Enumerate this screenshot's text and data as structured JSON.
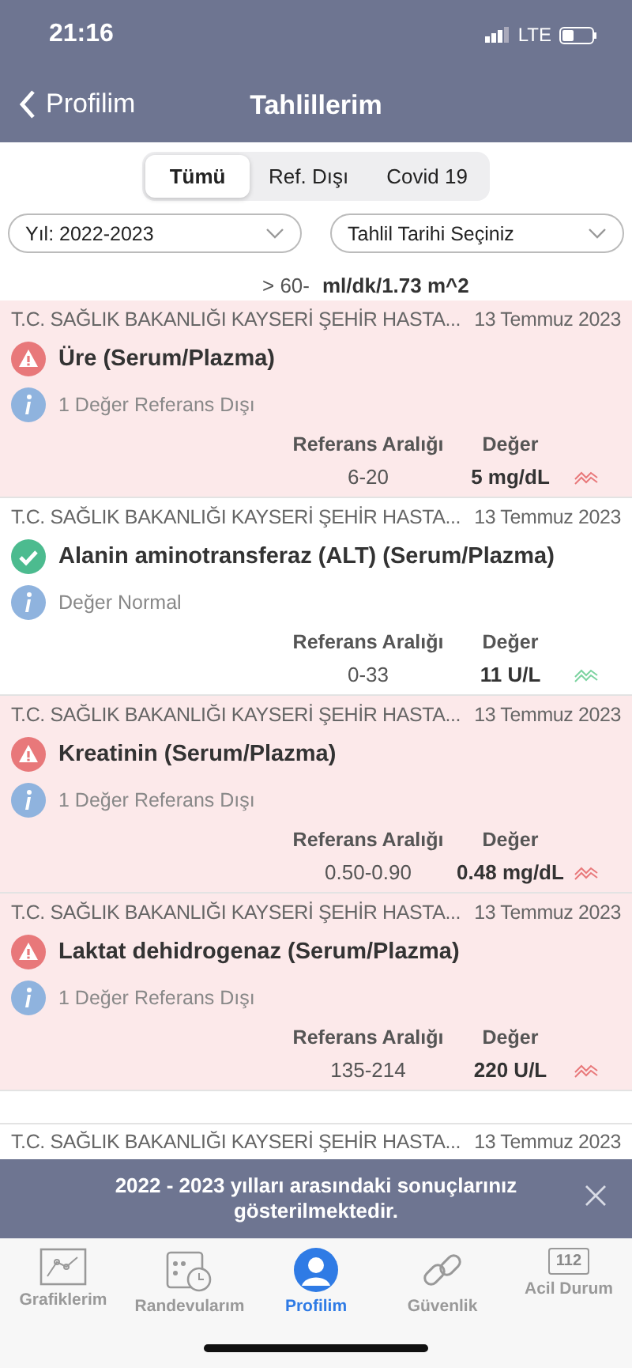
{
  "status_bar": {
    "time": "21:16",
    "network": "LTE"
  },
  "nav": {
    "back": "Profilim",
    "title": "Tahlillerim"
  },
  "segments": [
    {
      "label": "Tümü",
      "selected": true
    },
    {
      "label": "Ref. Dışı",
      "selected": false
    },
    {
      "label": "Covid 19",
      "selected": false
    }
  ],
  "filters": [
    {
      "value": "Yıl: 2022-2023"
    },
    {
      "value": "Tahlil Tarihi Seçiniz"
    }
  ],
  "partial_row": {
    "range": "> 60-",
    "value": "ml/dk/1.73 m^2"
  },
  "results": [
    {
      "hospital": "T.C. SAĞLIK BAKANLIĞI KAYSERİ ŞEHİR HASTA...",
      "date": "13 Temmuz 2023",
      "kind": "abnormal",
      "title": "Üre (Serum/Plazma)",
      "note": "1 Değer Referans Dışı",
      "range_label": "Referans Aralığı",
      "value_label": "Değer",
      "range": "6-20",
      "value": "5 mg/dL"
    },
    {
      "hospital": "T.C. SAĞLIK BAKANLIĞI KAYSERİ ŞEHİR HASTA...",
      "date": "13 Temmuz 2023",
      "kind": "normal",
      "title": "Alanin aminotransferaz (ALT) (Serum/Plazma)",
      "note": "Değer Normal",
      "range_label": "Referans Aralığı",
      "value_label": "Değer",
      "range": "0-33",
      "value": "11 U/L"
    },
    {
      "hospital": "T.C. SAĞLIK BAKANLIĞI KAYSERİ ŞEHİR HASTA...",
      "date": "13 Temmuz 2023",
      "kind": "abnormal",
      "title": "Kreatinin (Serum/Plazma)",
      "note": "1 Değer Referans Dışı",
      "range_label": "Referans Aralığı",
      "value_label": "Değer",
      "range": "0.50-0.90",
      "value": "0.48 mg/dL"
    },
    {
      "hospital": "T.C. SAĞLIK BAKANLIĞI KAYSERİ ŞEHİR HASTA...",
      "date": "13 Temmuz 2023",
      "kind": "abnormal",
      "title": "Laktat dehidrogenaz (Serum/Plazma)",
      "note": "1 Değer Referans Dışı",
      "range_label": "Referans Aralığı",
      "value_label": "Değer",
      "range": "135-214",
      "value": "220 U/L"
    }
  ],
  "partial_result": {
    "hospital": "T.C. SAĞLIK BAKANLIĞI KAYSERİ ŞEHİR HASTA...",
    "date": "13 Temmuz 2023"
  },
  "banner": {
    "message": "2022 - 2023 yılları arasındaki sonuçlarınız gösterilmektedir."
  },
  "tab_bar": [
    {
      "kind": "chart",
      "label": "Grafiklerim",
      "selected": false
    },
    {
      "kind": "calendar",
      "label": "Randevularım",
      "selected": false
    },
    {
      "kind": "profile",
      "label": "Profilim",
      "selected": true
    },
    {
      "kind": "link",
      "label": "Güvenlik",
      "selected": false
    },
    {
      "kind": "emergency",
      "label": "Acil Durum",
      "badge": "112",
      "selected": false
    }
  ]
}
